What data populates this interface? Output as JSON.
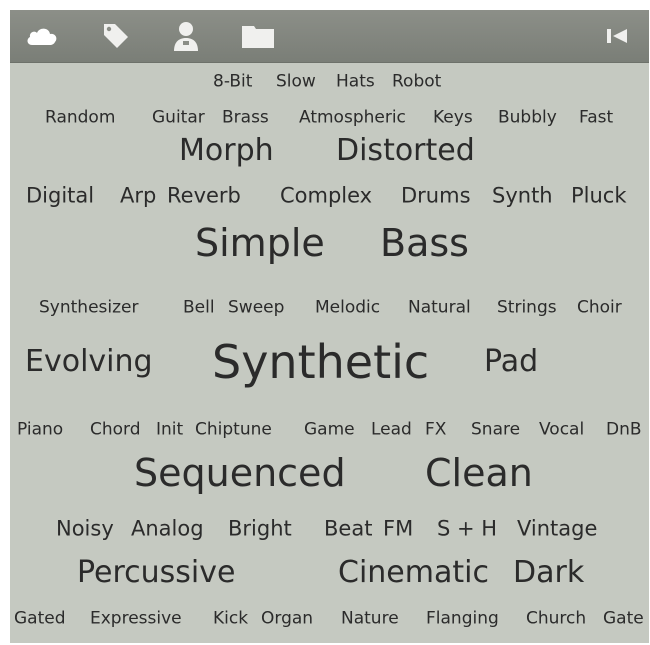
{
  "toolbar": {
    "icons": [
      "cloud-icon",
      "tag-icon",
      "user-icon",
      "folder-icon",
      "skip-back-icon"
    ]
  },
  "tags": {
    "r1": [
      "8-Bit",
      "Slow",
      "Hats",
      "Robot"
    ],
    "r2": [
      "Random",
      "Guitar",
      "Brass",
      "Atmospheric",
      "Keys",
      "Bubbly",
      "Fast"
    ],
    "r3": [
      "Morph",
      "Distorted"
    ],
    "r4": [
      "Digital",
      "Arp",
      "Reverb",
      "Complex",
      "Drums",
      "Synth",
      "Pluck"
    ],
    "r5": [
      "Simple",
      "Bass"
    ],
    "r6": [
      "Synthesizer",
      "Bell",
      "Sweep",
      "Melodic",
      "Natural",
      "Strings",
      "Choir"
    ],
    "r7": [
      "Evolving",
      "Synthetic",
      "Pad"
    ],
    "r8": [
      "Piano",
      "Chord",
      "Init",
      "Chiptune",
      "Game",
      "Lead",
      "FX",
      "Snare",
      "Vocal",
      "DnB"
    ],
    "r9": [
      "Sequenced",
      "Clean"
    ],
    "r10": [
      "Noisy",
      "Analog",
      "Bright",
      "Beat",
      "FM",
      "S + H",
      "Vintage"
    ],
    "r11": [
      "Percussive",
      "Cinematic",
      "Dark"
    ],
    "r12": [
      "Gated",
      "Expressive",
      "Kick",
      "Organ",
      "Nature",
      "Flanging",
      "Church",
      "Gate"
    ]
  }
}
